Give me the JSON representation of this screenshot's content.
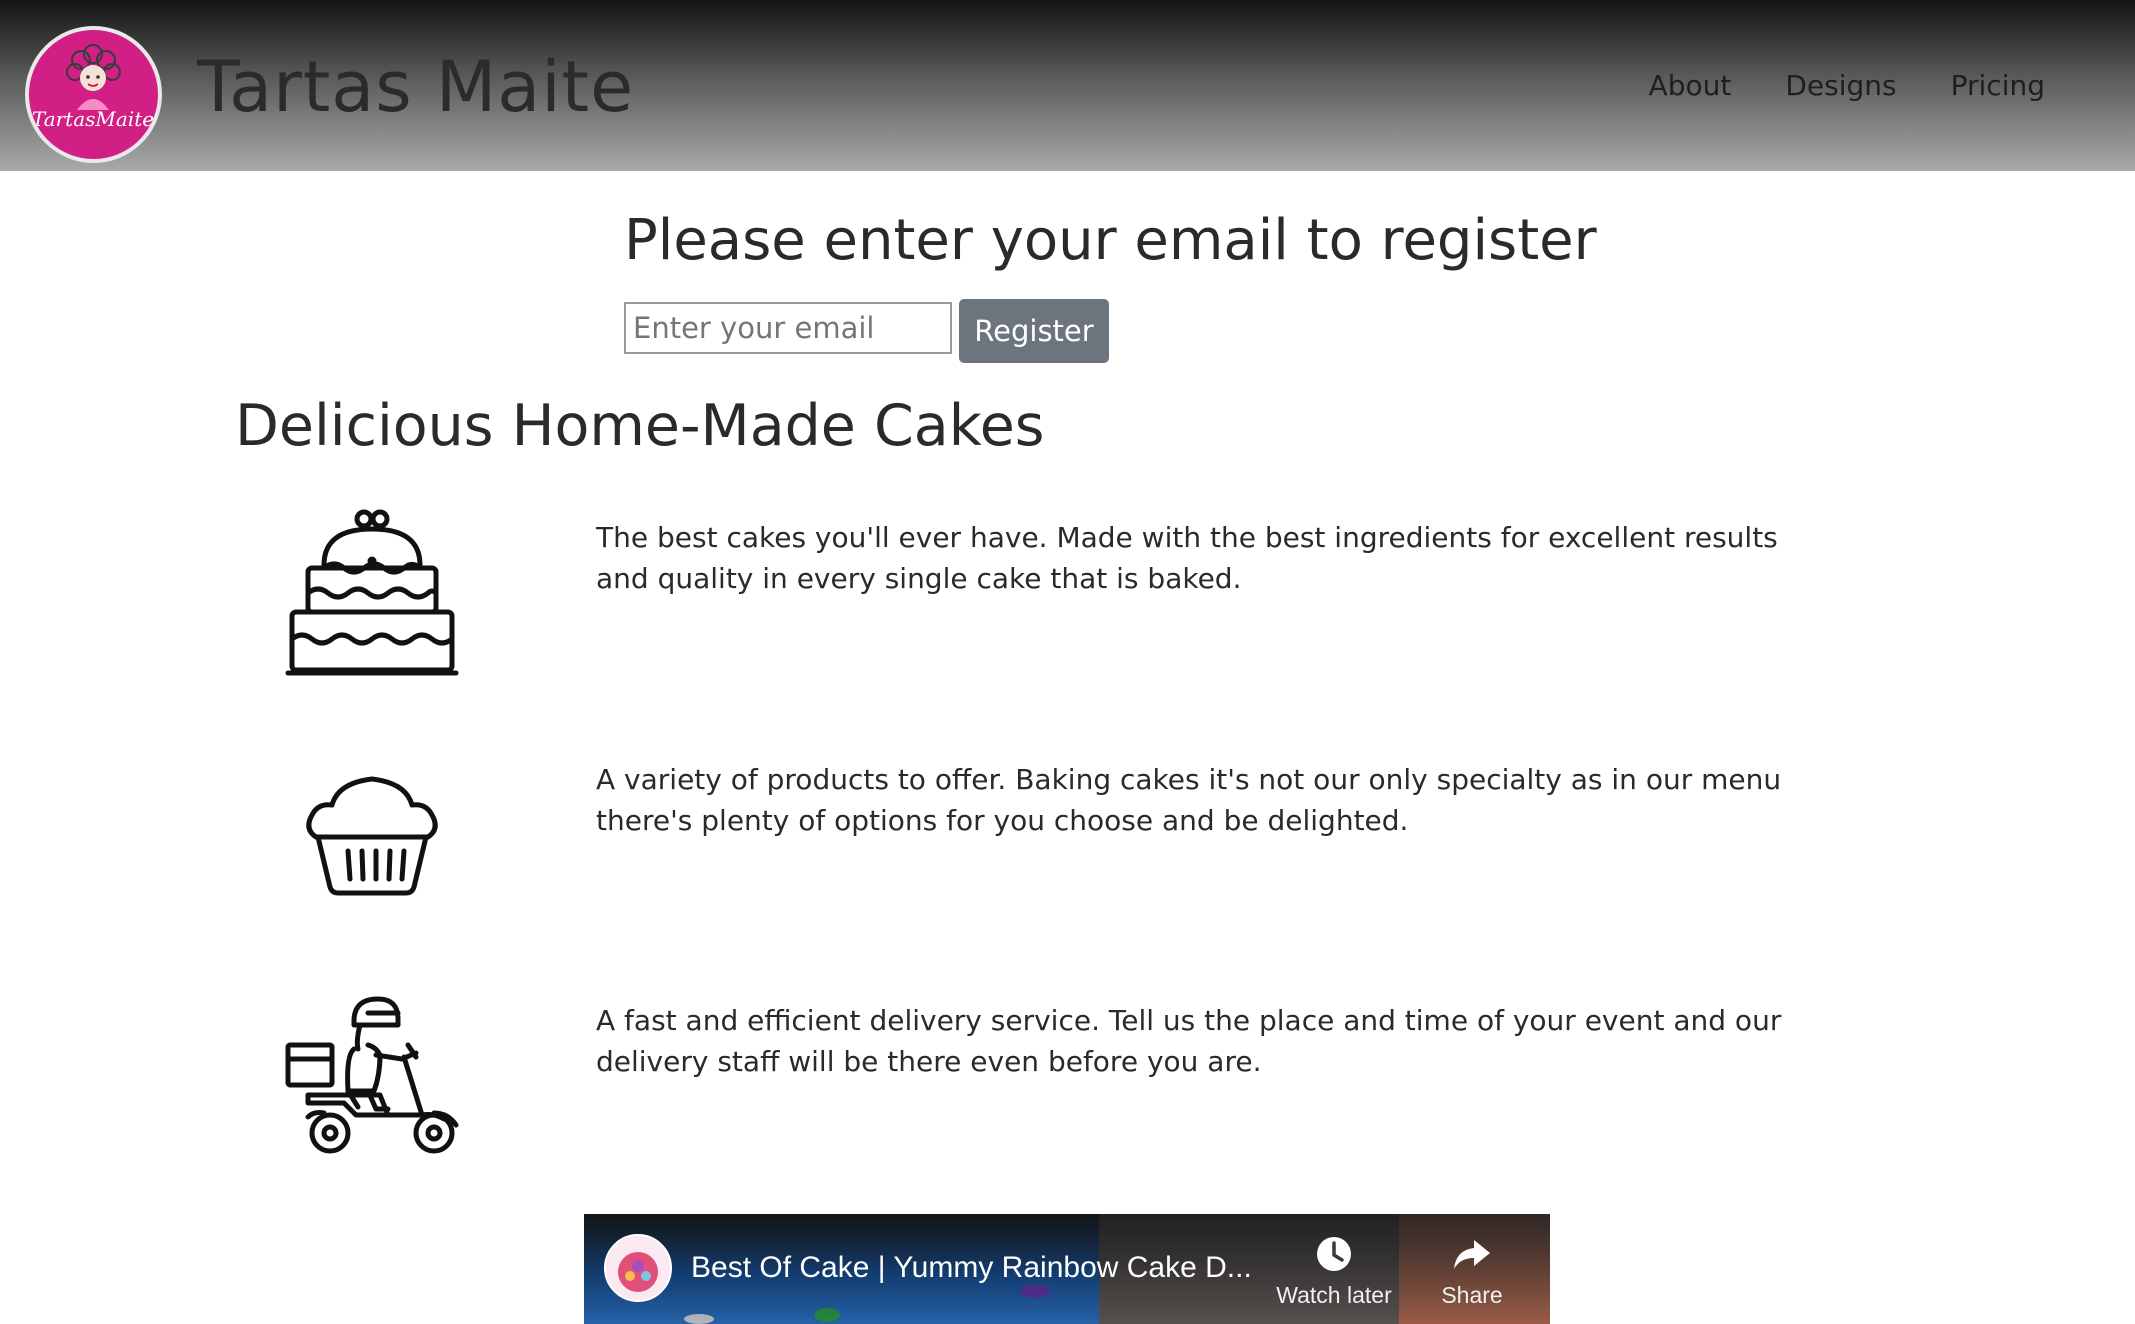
{
  "header": {
    "brand": "Tartas Maite",
    "logo_alt": "TartasMaite",
    "nav": [
      "About",
      "Designs",
      "Pricing"
    ]
  },
  "register": {
    "title": "Please enter your email to register",
    "email_placeholder": "Enter your email",
    "button_label": "Register"
  },
  "features": {
    "title": "Delicious Home-Made Cakes",
    "items": [
      {
        "icon": "cake-icon",
        "text": "The best cakes you'll ever have. Made with the best ingredients for excellent results and quality in every single cake that is baked."
      },
      {
        "icon": "cupcake-icon",
        "text": "A variety of products to offer. Baking cakes it's not our only specialty as in our menu there's plenty of options for you choose and be delighted."
      },
      {
        "icon": "delivery-scooter-icon",
        "text": "A fast and efficient delivery service. Tell us the place and time of your event and our delivery staff will be there even before you are."
      }
    ]
  },
  "video": {
    "title": "Best Of Cake | Yummy Rainbow Cake D...",
    "watch_later": "Watch later",
    "share": "Share"
  },
  "colors": {
    "logo_background": "#d21f86",
    "register_button": "#6c757d",
    "header_gradient_top": "#141414",
    "header_gradient_bottom": "#a9a9a9"
  }
}
